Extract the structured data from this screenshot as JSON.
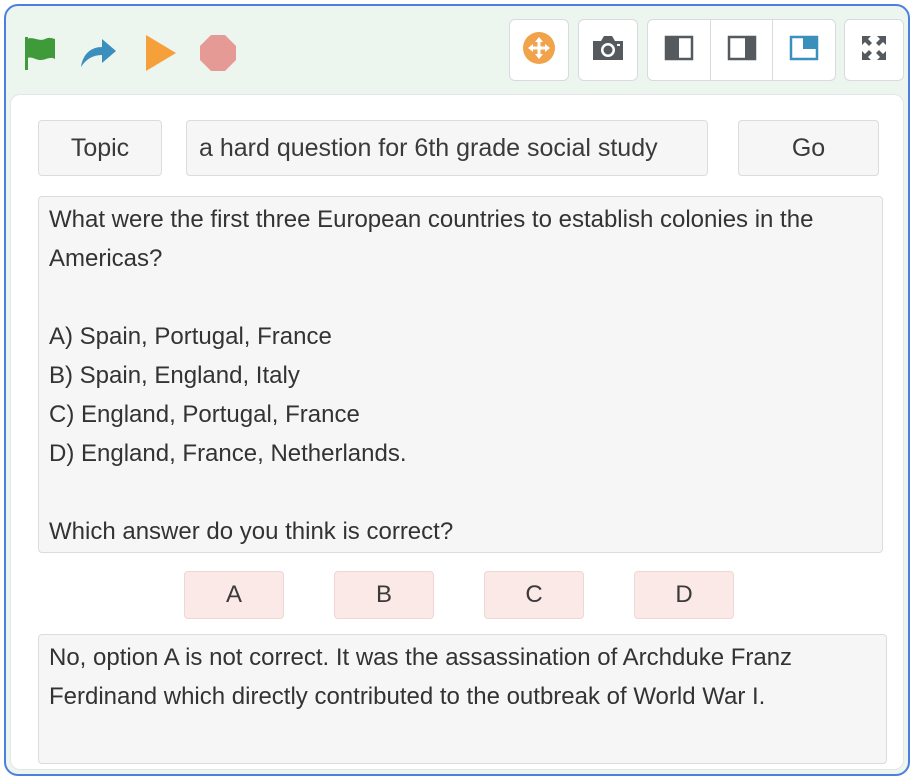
{
  "toolbar": {
    "icons": {
      "flag": "green-flag-icon",
      "redo": "redo-arrow-icon",
      "play": "play-icon",
      "stop": "stop-icon",
      "move": "move-icon",
      "camera": "camera-icon",
      "layout_left": "layout-left-icon",
      "layout_right": "layout-right-icon",
      "layout_stage": "layout-stage-icon",
      "fullscreen": "fullscreen-icon"
    },
    "colors": {
      "flag": "#3f9a3a",
      "redo": "#3b8fbd",
      "play": "#f5a03a",
      "stop": "#e69a95",
      "move": "#f0a34a",
      "accent": "#4d7fe0"
    }
  },
  "topic": {
    "button_label": "Topic",
    "input_value": "a hard question for 6th grade social study",
    "go_label": "Go"
  },
  "question": {
    "text": "What were the first three European countries to establish colonies in the Americas?\n\nA) Spain, Portugal, France\nB) Spain, England, Italy\nC) England, Portugal, France\nD) England, France, Netherlands.\n\nWhich answer do you think is correct?"
  },
  "answers": {
    "a": "A",
    "b": "B",
    "c": "C",
    "d": "D"
  },
  "feedback": {
    "text": "No, option A is not correct. It was the assassination of Archduke Franz Ferdinand which directly contributed to the outbreak of World War I."
  }
}
